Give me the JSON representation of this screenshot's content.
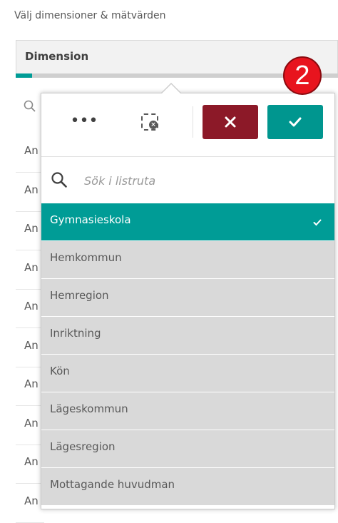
{
  "heading": "Välj dimensioner & mätvärden",
  "dimension": {
    "label": "Dimension",
    "progress_fraction": 0.05
  },
  "step_badge": "2",
  "background_rows": [
    "An",
    "An",
    "An",
    "An",
    "An",
    "An",
    "An",
    "An",
    "An",
    "An"
  ],
  "popover": {
    "toolbar": {
      "more_label": "•••",
      "clear_icon": "clear-selections-icon",
      "cancel_icon": "close-icon",
      "confirm_icon": "checkmark-icon"
    },
    "search": {
      "placeholder": "Sök i listruta"
    },
    "items": [
      {
        "label": "Gymnasieskola",
        "selected": true
      },
      {
        "label": "Hemkommun",
        "selected": false
      },
      {
        "label": "Hemregion",
        "selected": false
      },
      {
        "label": "Inriktning",
        "selected": false
      },
      {
        "label": "Kön",
        "selected": false
      },
      {
        "label": "Lägeskommun",
        "selected": false
      },
      {
        "label": "Lägesregion",
        "selected": false
      },
      {
        "label": "Mottagande huvudman",
        "selected": false
      }
    ]
  },
  "colors": {
    "accent": "#009c96",
    "cancel": "#8c1928",
    "badge": "#e8141e"
  }
}
